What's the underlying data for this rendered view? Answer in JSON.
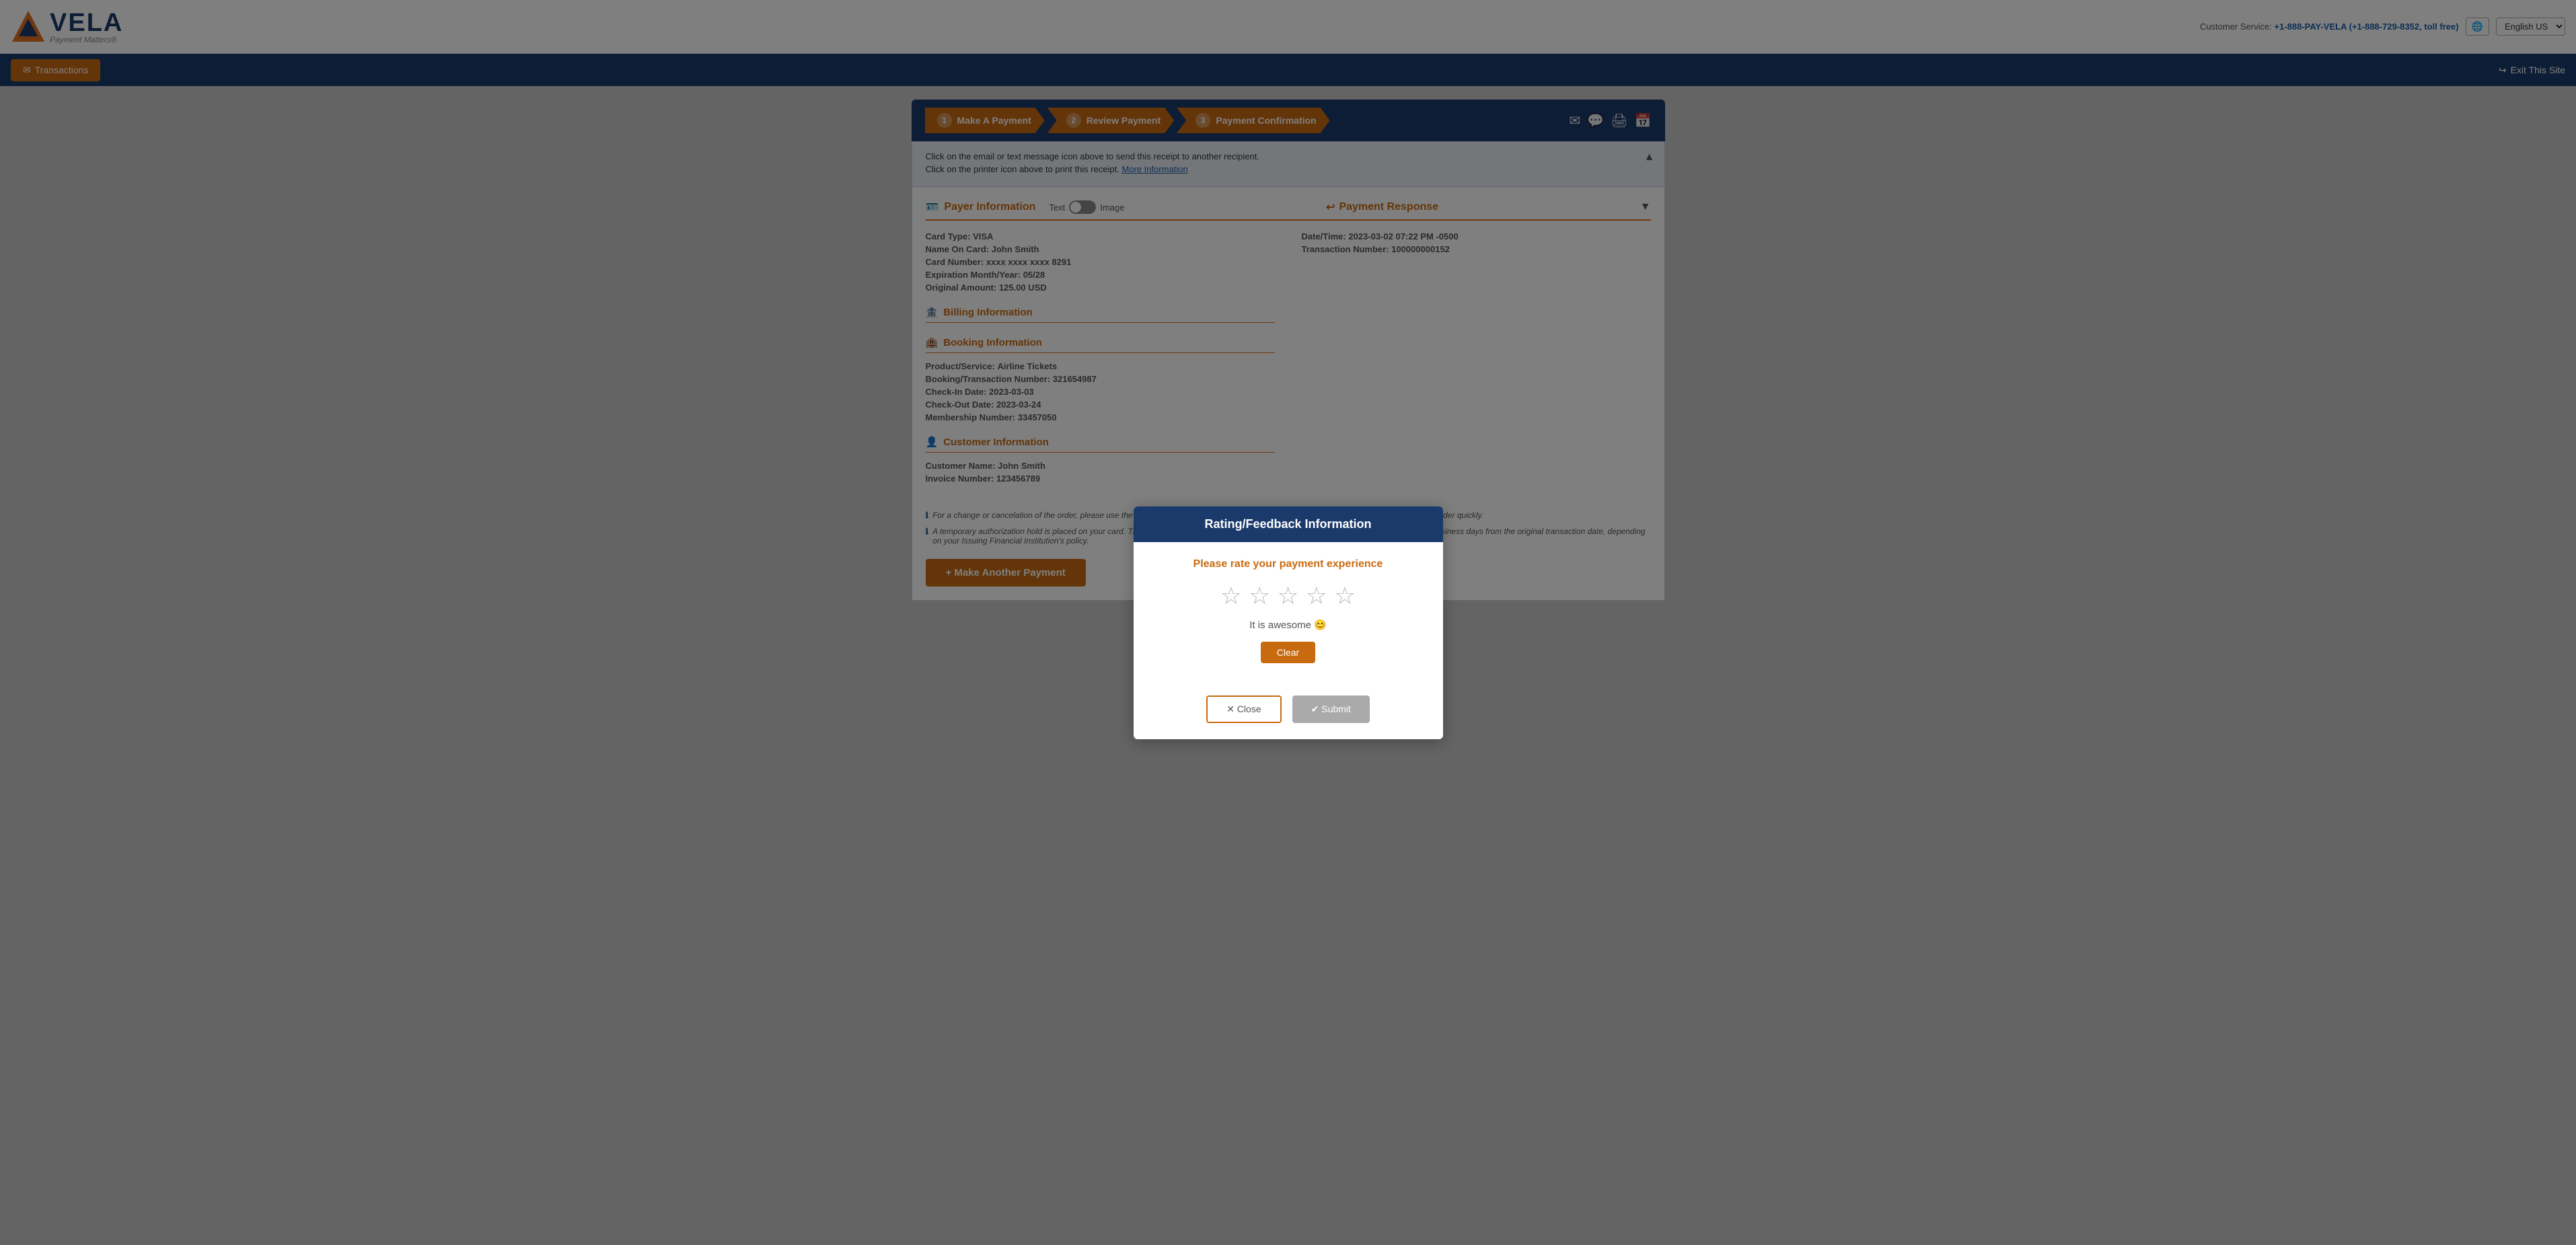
{
  "topBar": {
    "logoText": "VELA",
    "logoTagline": "Payment Matters®",
    "customerServiceLabel": "Customer Service:",
    "customerServicePhone": "+1-888-PAY-VELA (+1-888-729-8352, toll free)",
    "languageLabel": "English US"
  },
  "navBar": {
    "transactionsLabel": "Transactions",
    "exitLabel": "Exit This Site"
  },
  "steps": [
    {
      "num": "1",
      "label": "Make A Payment"
    },
    {
      "num": "2",
      "label": "Review Payment"
    },
    {
      "num": "3",
      "label": "Payment Confirmation"
    }
  ],
  "infoBanner": {
    "line1": "Click on the email or text message icon above to send this receipt to another recipient.",
    "line2": "Click on the printer icon above to print this receipt.",
    "linkText": "More Information"
  },
  "receiptTabs": {
    "textLabel": "Text",
    "imageLabel": "Image"
  },
  "payerInfo": {
    "title": "Payer Information",
    "cardTypeLabel": "Card Type:",
    "cardTypeValue": "VISA",
    "nameLabel": "Name On Card:",
    "nameValue": "John Smith",
    "cardNumberLabel": "Card Number:",
    "cardNumberValue": "xxxx xxxx xxxx 8291",
    "expirationLabel": "Expiration Month/Year:",
    "expirationValue": "05/28",
    "amountLabel": "Original Amount:",
    "amountValue": "125.00 USD"
  },
  "billingInfo": {
    "title": "Billing Information"
  },
  "bookingInfo": {
    "title": "Booking Information",
    "productLabel": "Product/Service:",
    "productValue": "Airline Tickets",
    "bookingNumLabel": "Booking/Transaction Number:",
    "bookingNumValue": "321654987",
    "checkInLabel": "Check-In Date:",
    "checkInValue": "2023-03-03",
    "checkOutLabel": "Check-Out Date:",
    "checkOutValue": "2023-03-24",
    "membershipLabel": "Membership Number:",
    "membershipValue": "33457050"
  },
  "customerInfo": {
    "title": "Customer Information",
    "nameLabel": "Customer Name:",
    "nameValue": "John Smith",
    "invoiceLabel": "Invoice Number:",
    "invoiceValue": "123456789"
  },
  "paymentResponse": {
    "title": "Payment Response",
    "dateLabel": "Date/Time:",
    "dateValue": "2023-03-02 07:22 PM -0500",
    "transactionLabel": "Transaction Number:",
    "transactionValue": "100000000152"
  },
  "footerNotes": [
    "For a change or cancelation of the order, please use the Order Id and/or Invoice Number as the reference in the communication to locate the order quickly.",
    "A temporary authorization hold is placed on your card. The authorization hold will be automatically released anywhere between one and ten business days from the original transaction date, depending on your Issuing Financial Institution's policy."
  ],
  "makeAnotherPaymentBtn": "+ Make Another Payment",
  "modal": {
    "title": "Rating/Feedback Information",
    "prompt": "Please rate your payment experience",
    "stars": [
      {
        "filled": false,
        "value": 1
      },
      {
        "filled": false,
        "value": 2
      },
      {
        "filled": false,
        "value": 3
      },
      {
        "filled": false,
        "value": 4
      },
      {
        "filled": false,
        "value": 5
      }
    ],
    "ratingLabel": "It is awesome 😊",
    "clearBtn": "Clear",
    "closeBtn": "✕ Close",
    "submitBtn": "✔ Submit"
  }
}
